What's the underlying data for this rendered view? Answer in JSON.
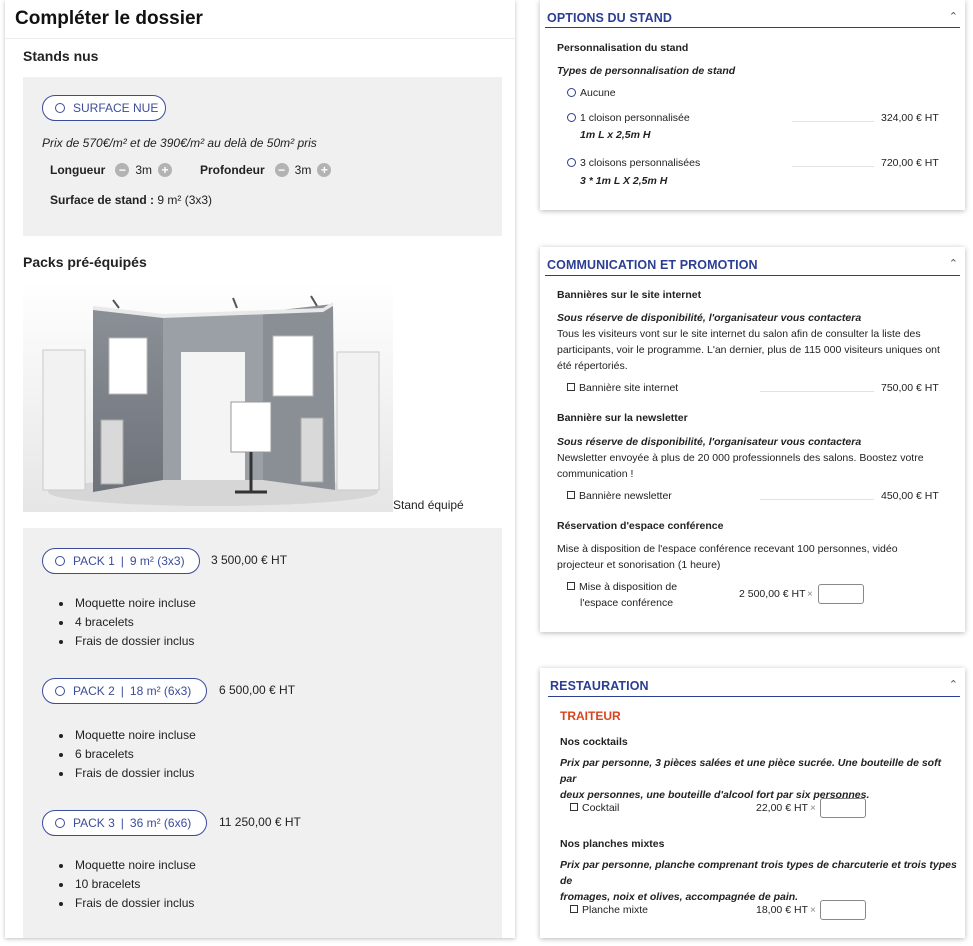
{
  "left": {
    "title": "Compléter le dossier",
    "stands_nus": {
      "title": "Stands nus",
      "option_label": "SURFACE NUE",
      "price_note": "Prix de 570€/m² et de 390€/m² au delà de 50m² pris",
      "longueur_label": "Longueur",
      "longueur_value": "3m",
      "profondeur_label": "Profondeur",
      "profondeur_value": "3m",
      "surface_label": "Surface de stand :",
      "surface_value": "9 m² (3x3)"
    },
    "packs": {
      "title": "Packs pré-équipés",
      "image_caption": "Stand équipé",
      "items": [
        {
          "name": "PACK 1",
          "size": "9 m² (3x3)",
          "price": "3 500,00 € HT",
          "features": [
            "Moquette noire incluse",
            "4 bracelets",
            "Frais de dossier inclus"
          ]
        },
        {
          "name": "PACK 2",
          "size": "18 m² (6x3)",
          "price": "6 500,00 € HT",
          "features": [
            "Moquette noire incluse",
            "6 bracelets",
            "Frais de dossier inclus"
          ]
        },
        {
          "name": "PACK 3",
          "size": "36 m² (6x6)",
          "price": "11 250,00 € HT",
          "features": [
            "Moquette noire incluse",
            "10 bracelets",
            "Frais de dossier inclus"
          ]
        }
      ]
    }
  },
  "options_stand": {
    "title": "OPTIONS DU STAND",
    "section": "Personnalisation du stand",
    "subsection": "Types de personnalisation de stand",
    "choices": [
      {
        "label": "Aucune",
        "sub": "",
        "price": ""
      },
      {
        "label": "1 cloison personnalisée",
        "sub": "1m L x 2,5m H",
        "price": "324,00 € HT"
      },
      {
        "label": "3 cloisons personnalisées",
        "sub": "3 * 1m L X 2,5m H",
        "price": "720,00 € HT"
      }
    ]
  },
  "communication": {
    "title": "COMMUNICATION ET PROMOTION",
    "site": {
      "heading": "Bannières sur le site internet",
      "note": "Sous réserve de disponibilité, l'organisateur vous contactera",
      "desc_lines": [
        "Tous les visiteurs vont sur le site internet du salon afin de consulter la liste des",
        "participants, voir le programme. L'an dernier, plus de 115 000 visiteurs uniques ont",
        "été répertoriés."
      ],
      "item_label": "Bannière site internet",
      "item_price": "750,00 € HT"
    },
    "newsletter": {
      "heading": "Bannière sur la newsletter",
      "note": "Sous réserve de disponibilité, l'organisateur vous contactera",
      "desc_lines": [
        "Newsletter envoyée à plus de 20 000 professionnels des salons. Boostez votre",
        "communication !"
      ],
      "item_label": "Bannière newsletter",
      "item_price": "450,00 € HT"
    },
    "conference": {
      "heading": "Réservation d'espace conférence",
      "desc_lines": [
        "Mise à disposition de l'espace conférence recevant 100 personnes, vidéo",
        "projecteur et sonorisation (1 heure)"
      ],
      "item_label_lines": [
        "Mise à disposition de",
        "l'espace conférence"
      ],
      "item_price": "2 500,00 € HT",
      "times": "×",
      "qty_value": ""
    }
  },
  "restauration": {
    "title": "RESTAURATION",
    "category": "TRAITEUR",
    "cocktails": {
      "heading": "Nos cocktails",
      "desc_lines": [
        "Prix par personne, 3 pièces salées et une pièce sucrée. Une bouteille de soft par",
        "deux personnes, une bouteille d'alcool fort par six personnes."
      ],
      "item_label": "Cocktail",
      "item_price": "22,00 € HT",
      "times": "×",
      "qty_value": ""
    },
    "planches": {
      "heading": "Nos planches mixtes",
      "desc_lines": [
        "Prix par personne, planche comprenant trois types de charcuterie et trois types de",
        "fromages, noix et olives, accompagnée de pain."
      ],
      "item_label": "Planche mixte",
      "item_price": "18,00 € HT",
      "times": "×",
      "qty_value": ""
    }
  },
  "icons": {
    "collapse": "chevron-up-icon",
    "minus": "minus-circle-icon",
    "plus": "plus-circle-icon"
  },
  "colors": {
    "accent": "#2c3e94",
    "traiteur": "#d9441c",
    "grey_panel": "#f0f0f0"
  }
}
